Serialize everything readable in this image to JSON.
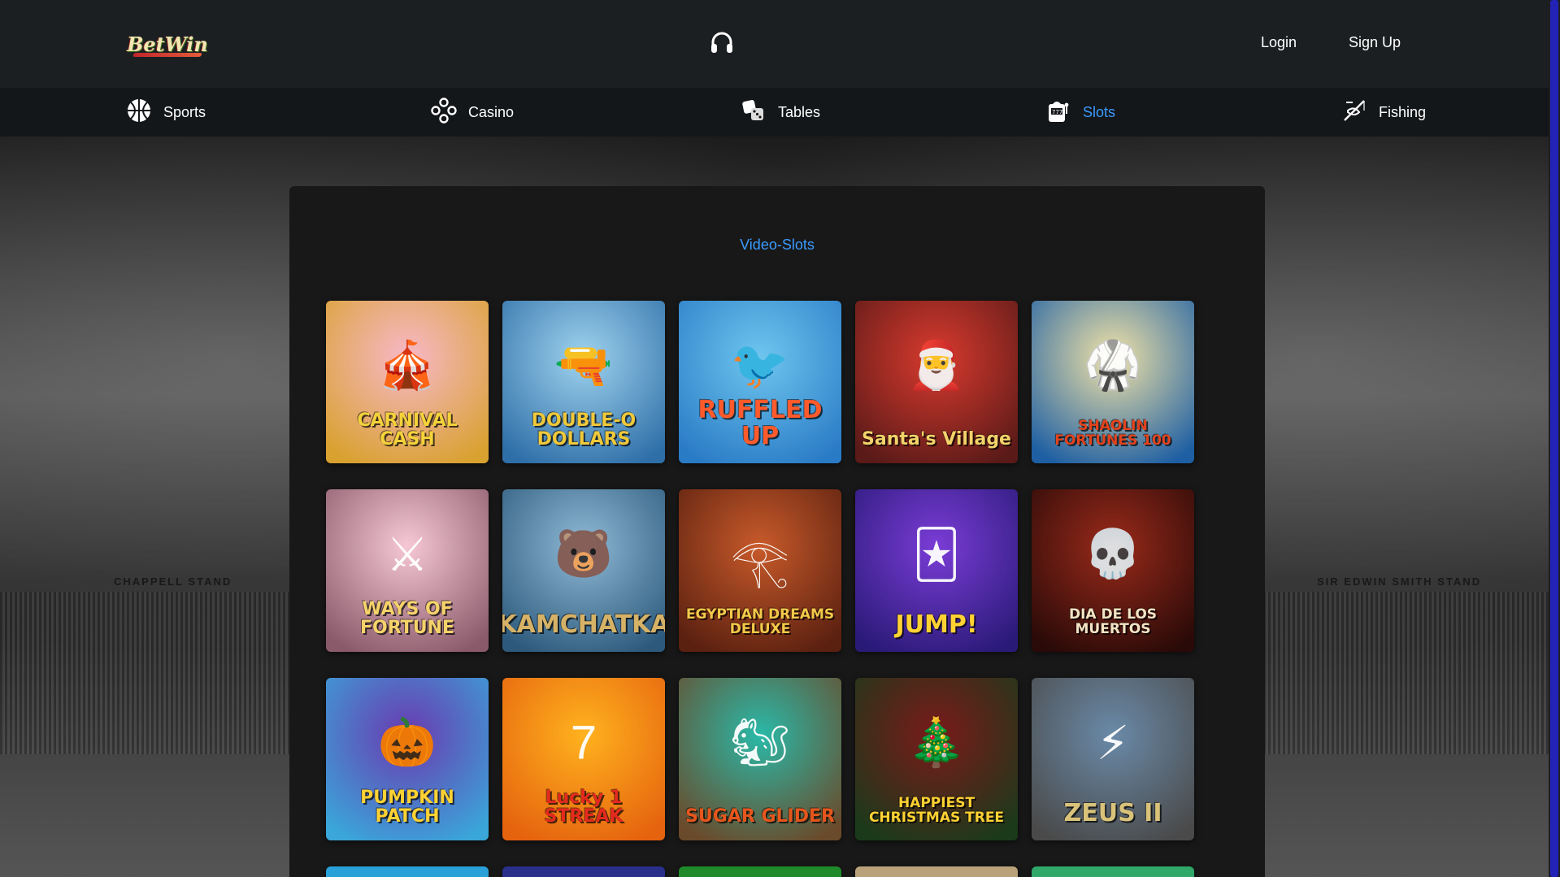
{
  "header": {
    "logo_text": "BetWin",
    "support_icon": "headset-icon",
    "login_label": "Login",
    "signup_label": "Sign Up"
  },
  "nav": {
    "items": [
      {
        "label": "Sports",
        "icon": "basketball-icon",
        "active": false
      },
      {
        "label": "Casino",
        "icon": "casino-chips-icon",
        "active": false
      },
      {
        "label": "Tables",
        "icon": "dice-icon",
        "active": false
      },
      {
        "label": "Slots",
        "icon": "slot-machine-icon",
        "active": true
      },
      {
        "label": "Fishing",
        "icon": "fishing-rod-icon",
        "active": false
      }
    ]
  },
  "background": {
    "stand_left": "CHAPPELL STAND",
    "stand_right": "SIR EDWIN SMITH STAND"
  },
  "section": {
    "title": "Video-Slots"
  },
  "games": [
    {
      "title": "CARNIVAL CASH",
      "color1": "#f7b8c8",
      "color2": "#d9a12f",
      "text_color": "#f4d23a"
    },
    {
      "title": "DOUBLE-O DOLLARS",
      "color1": "#9fd3ee",
      "color2": "#2f6fa8",
      "text_color": "#f0c93a"
    },
    {
      "title": "RUFFLED UP",
      "color1": "#6ec6ee",
      "color2": "#2a7bc6",
      "text_color": "#ff5a2c"
    },
    {
      "title": "Santa's Village",
      "color1": "#d93a2e",
      "color2": "#5a1a18",
      "text_color": "#f2d36a"
    },
    {
      "title": "SHAOLIN FORTUNES 100",
      "color1": "#f2e3a6",
      "color2": "#1e5fa3",
      "text_color": "#e3431d"
    },
    {
      "title": "WAYS OF FORTUNE",
      "color1": "#f6c7d4",
      "color2": "#8a5a6a",
      "text_color": "#f6d36a"
    },
    {
      "title": "KAMCHATKA",
      "color1": "#8fb9d6",
      "color2": "#2d5a7c",
      "text_color": "#d6b267"
    },
    {
      "title": "EGYPTIAN DREAMS DELUXE",
      "color1": "#c85a2a",
      "color2": "#5a2010",
      "text_color": "#f3c94a"
    },
    {
      "title": "JUMP!",
      "color1": "#7a3cd6",
      "color2": "#2a1a78",
      "text_color": "#ffd233"
    },
    {
      "title": "DIA DE LOS MUERTOS",
      "color1": "#9a2a1a",
      "color2": "#2a0a08",
      "text_color": "#f3e3c4"
    },
    {
      "title": "PUMPKIN PATCH",
      "color1": "#6a3ab0",
      "color2": "#3aa6d9",
      "text_color": "#ffd233"
    },
    {
      "title": "Lucky 1 STREAK",
      "color1": "#ffb21e",
      "color2": "#e5620e",
      "text_color": "#e42a1e"
    },
    {
      "title": "SUGAR GLIDER",
      "color1": "#2ab9a8",
      "color2": "#6a4a2a",
      "text_color": "#e6561c"
    },
    {
      "title": "HAPPIEST CHRISTMAS TREE",
      "color1": "#7a1a1a",
      "color2": "#1a3a1a",
      "text_color": "#ffd233"
    },
    {
      "title": "ZEUS II",
      "color1": "#6a8aa8",
      "color2": "#4a4a4a",
      "text_color": "#d9c27a"
    }
  ],
  "partial_games_colors": [
    "#29a0d8",
    "#2a2f8a",
    "#1e8a2a",
    "#b9a27a",
    "#2fa86a"
  ]
}
